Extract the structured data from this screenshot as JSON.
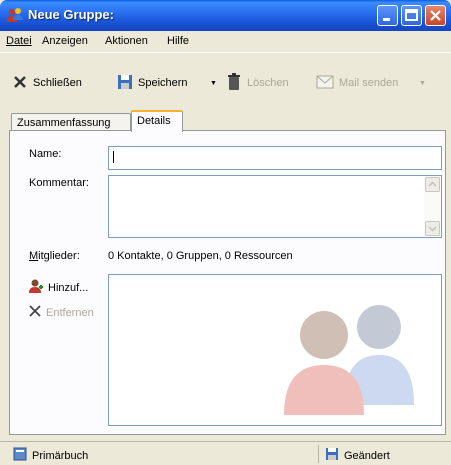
{
  "window": {
    "title": "Neue Gruppe:"
  },
  "menu": {
    "items": [
      {
        "label": "Datei"
      },
      {
        "label": "Anzeigen"
      },
      {
        "label": "Aktionen"
      },
      {
        "label": "Hilfe"
      }
    ]
  },
  "toolbar": {
    "close_label": "Schließen",
    "save_label": "Speichern",
    "delete_label": "Löschen",
    "mail_label": "Mail senden"
  },
  "tabs": [
    {
      "label": "Zusammenfassung"
    },
    {
      "label": "Details"
    }
  ],
  "form": {
    "name_label": "Name:",
    "name_value": "",
    "comment_label": "Kommentar:",
    "comment_value": "",
    "members_label": "Mitglieder:",
    "members_value": "0 Kontakte, 0 Gruppen, 0 Ressourcen",
    "add_label": "Hinzuf...",
    "remove_label": "Entfernen"
  },
  "status": {
    "book_label": "Primärbuch",
    "state_label": "Geändert"
  }
}
